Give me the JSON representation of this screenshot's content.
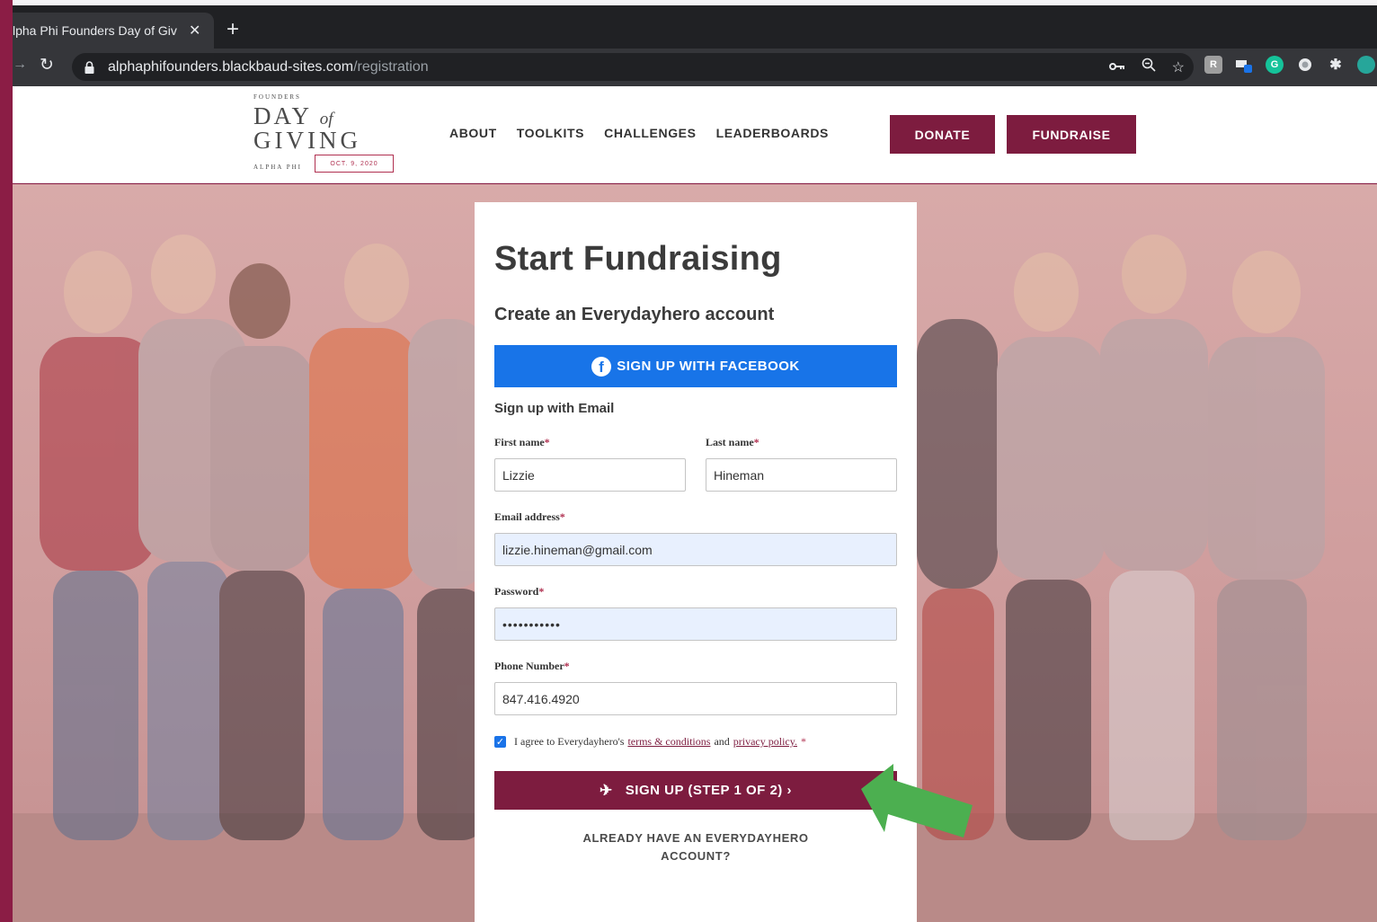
{
  "browser": {
    "tab_title": "lpha Phi Founders Day of Giv",
    "tab_close": "✕",
    "new_tab": "+",
    "url_host": "alphaphifounders.blackbaud-sites.com",
    "url_path": "/registration"
  },
  "logo": {
    "founders": "FOUNDERS",
    "day": "DAY",
    "of": "of",
    "giving": "GIVING",
    "alpha_phi": "ALPHA PHI",
    "date": "OCT. 9, 2020"
  },
  "nav": {
    "items": [
      "ABOUT",
      "TOOLKITS",
      "CHALLENGES",
      "LEADERBOARDS"
    ],
    "donate": "DONATE",
    "fundraise": "FUNDRAISE"
  },
  "form": {
    "title": "Start Fundraising",
    "subtitle": "Create an Everydayhero account",
    "facebook_btn": "SIGN UP WITH FACEBOOK",
    "email_heading": "Sign up with Email",
    "first_name_label": "First name",
    "first_name": "Lizzie",
    "last_name_label": "Last name",
    "last_name": "Hineman",
    "email_label": "Email address",
    "email": "lizzie.hineman@gmail.com",
    "password_label": "Password",
    "password": "•••••••••••",
    "phone_label": "Phone Number",
    "phone": "847.416.4920",
    "agree_prefix": "I agree to Everydayhero's",
    "terms_link": "terms & conditions",
    "agree_and": "and",
    "privacy_link": "privacy policy.",
    "required_mark": "*",
    "signup_btn": "SIGN UP (STEP 1 OF 2) ›",
    "already_line1": "ALREADY HAVE AN EVERYDAYHERO",
    "already_line2": "ACCOUNT?"
  },
  "colors": {
    "brand": "#7d1c3f",
    "facebook": "#1874e8",
    "arrow": "#4caf50"
  }
}
